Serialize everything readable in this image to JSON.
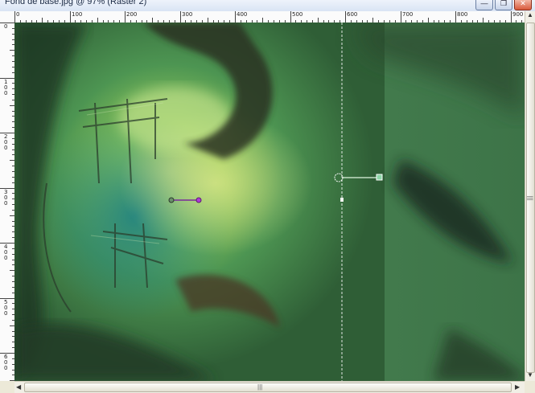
{
  "window": {
    "title": "Fond de base.jpg @ 97% (Raster 2)",
    "minimize_glyph": "—",
    "restore_glyph": "❐",
    "close_glyph": "✕"
  },
  "ruler_top": [
    "0",
    "100",
    "200",
    "300",
    "400",
    "500",
    "600",
    "700",
    "800",
    "900"
  ],
  "ruler_left": [
    "0",
    "100",
    "200",
    "300",
    "400",
    "500",
    "600"
  ],
  "scrollbars": {
    "up": "▲",
    "down": "▼",
    "left": "◀",
    "right": "▶",
    "grip": "|||"
  },
  "colors": {
    "canvas_dark": "#1f3a22",
    "canvas_mid": "#3f7a4a",
    "canvas_light": "#a8d668",
    "guide": "#ffffff",
    "handle_accent": "#b03ad8"
  },
  "icons": {
    "control_point": "circle-handle-icon",
    "rotation_handle": "square-handle-icon",
    "gradient_node": "gradient-node-icon"
  }
}
